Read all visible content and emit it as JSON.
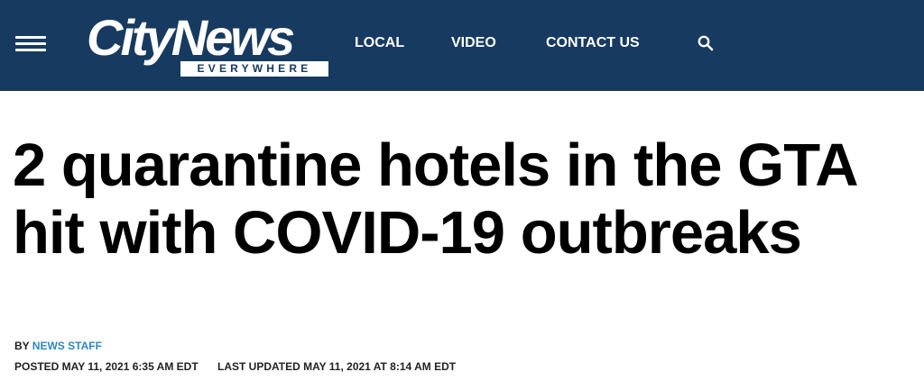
{
  "header": {
    "logo_main": "CityNews",
    "logo_tag": "EVERYWHERE",
    "nav": [
      {
        "label": "LOCAL"
      },
      {
        "label": "VIDEO"
      },
      {
        "label": "CONTACT US"
      }
    ],
    "menu_icon": "hamburger-menu-icon",
    "search_icon": "search-icon"
  },
  "article": {
    "headline": "2 quarantine hotels in the GTA hit with COVID-19 outbreaks",
    "by_prefix": "BY",
    "author": "NEWS STAFF",
    "posted": "POSTED MAY 11, 2021 6:35 AM EDT",
    "updated": "LAST UPDATED MAY 11, 2021 AT 8:14 AM EDT"
  },
  "colors": {
    "navbar_bg": "#173a60",
    "author_link": "#2f86c0"
  }
}
